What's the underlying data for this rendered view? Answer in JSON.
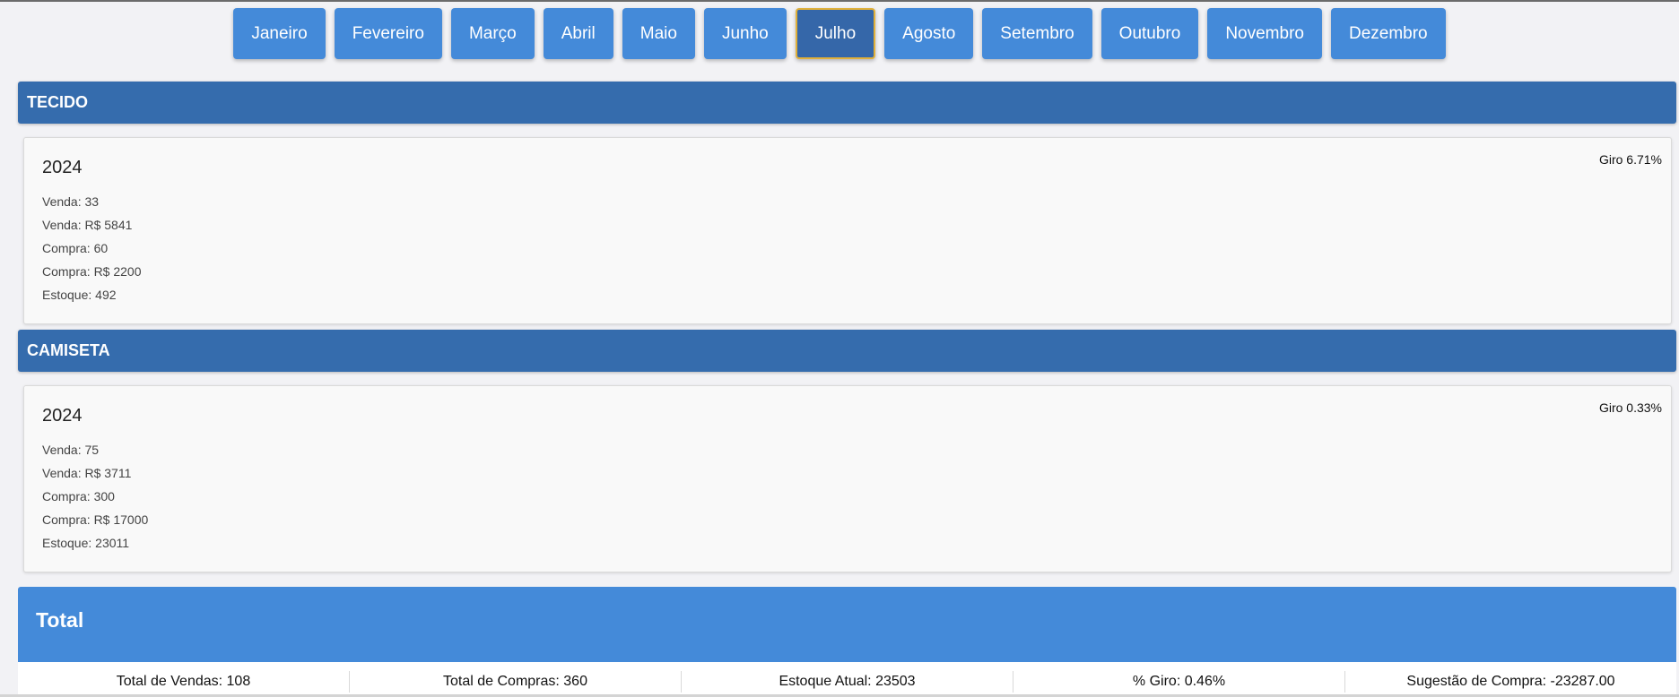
{
  "months": [
    "Janeiro",
    "Fevereiro",
    "Março",
    "Abril",
    "Maio",
    "Junho",
    "Julho",
    "Agosto",
    "Setembro",
    "Outubro",
    "Novembro",
    "Dezembro"
  ],
  "selected_month": "Julho",
  "sections": [
    {
      "title": "TECIDO",
      "year": "2024",
      "giro": "Giro 6.71%",
      "lines": [
        "Venda: 33",
        "Venda: R$ 5841",
        "Compra: 60",
        "Compra: R$ 2200",
        "Estoque: 492"
      ]
    },
    {
      "title": "CAMISETA",
      "year": "2024",
      "giro": "Giro 0.33%",
      "lines": [
        "Venda: 75",
        "Venda: R$ 3711",
        "Compra: 300",
        "Compra: R$ 17000",
        "Estoque: 23011"
      ]
    }
  ],
  "total": {
    "title": "Total",
    "items": [
      "Total de Vendas: 108",
      "Total de Compras: 360",
      "Estoque Atual: 23503",
      "% Giro: 0.46%",
      "Sugestão de Compra: -23287.00"
    ]
  },
  "colors": {
    "button": "#448ad9",
    "button_active": "#3567a9",
    "header": "#356cad",
    "total": "#448ad9"
  }
}
